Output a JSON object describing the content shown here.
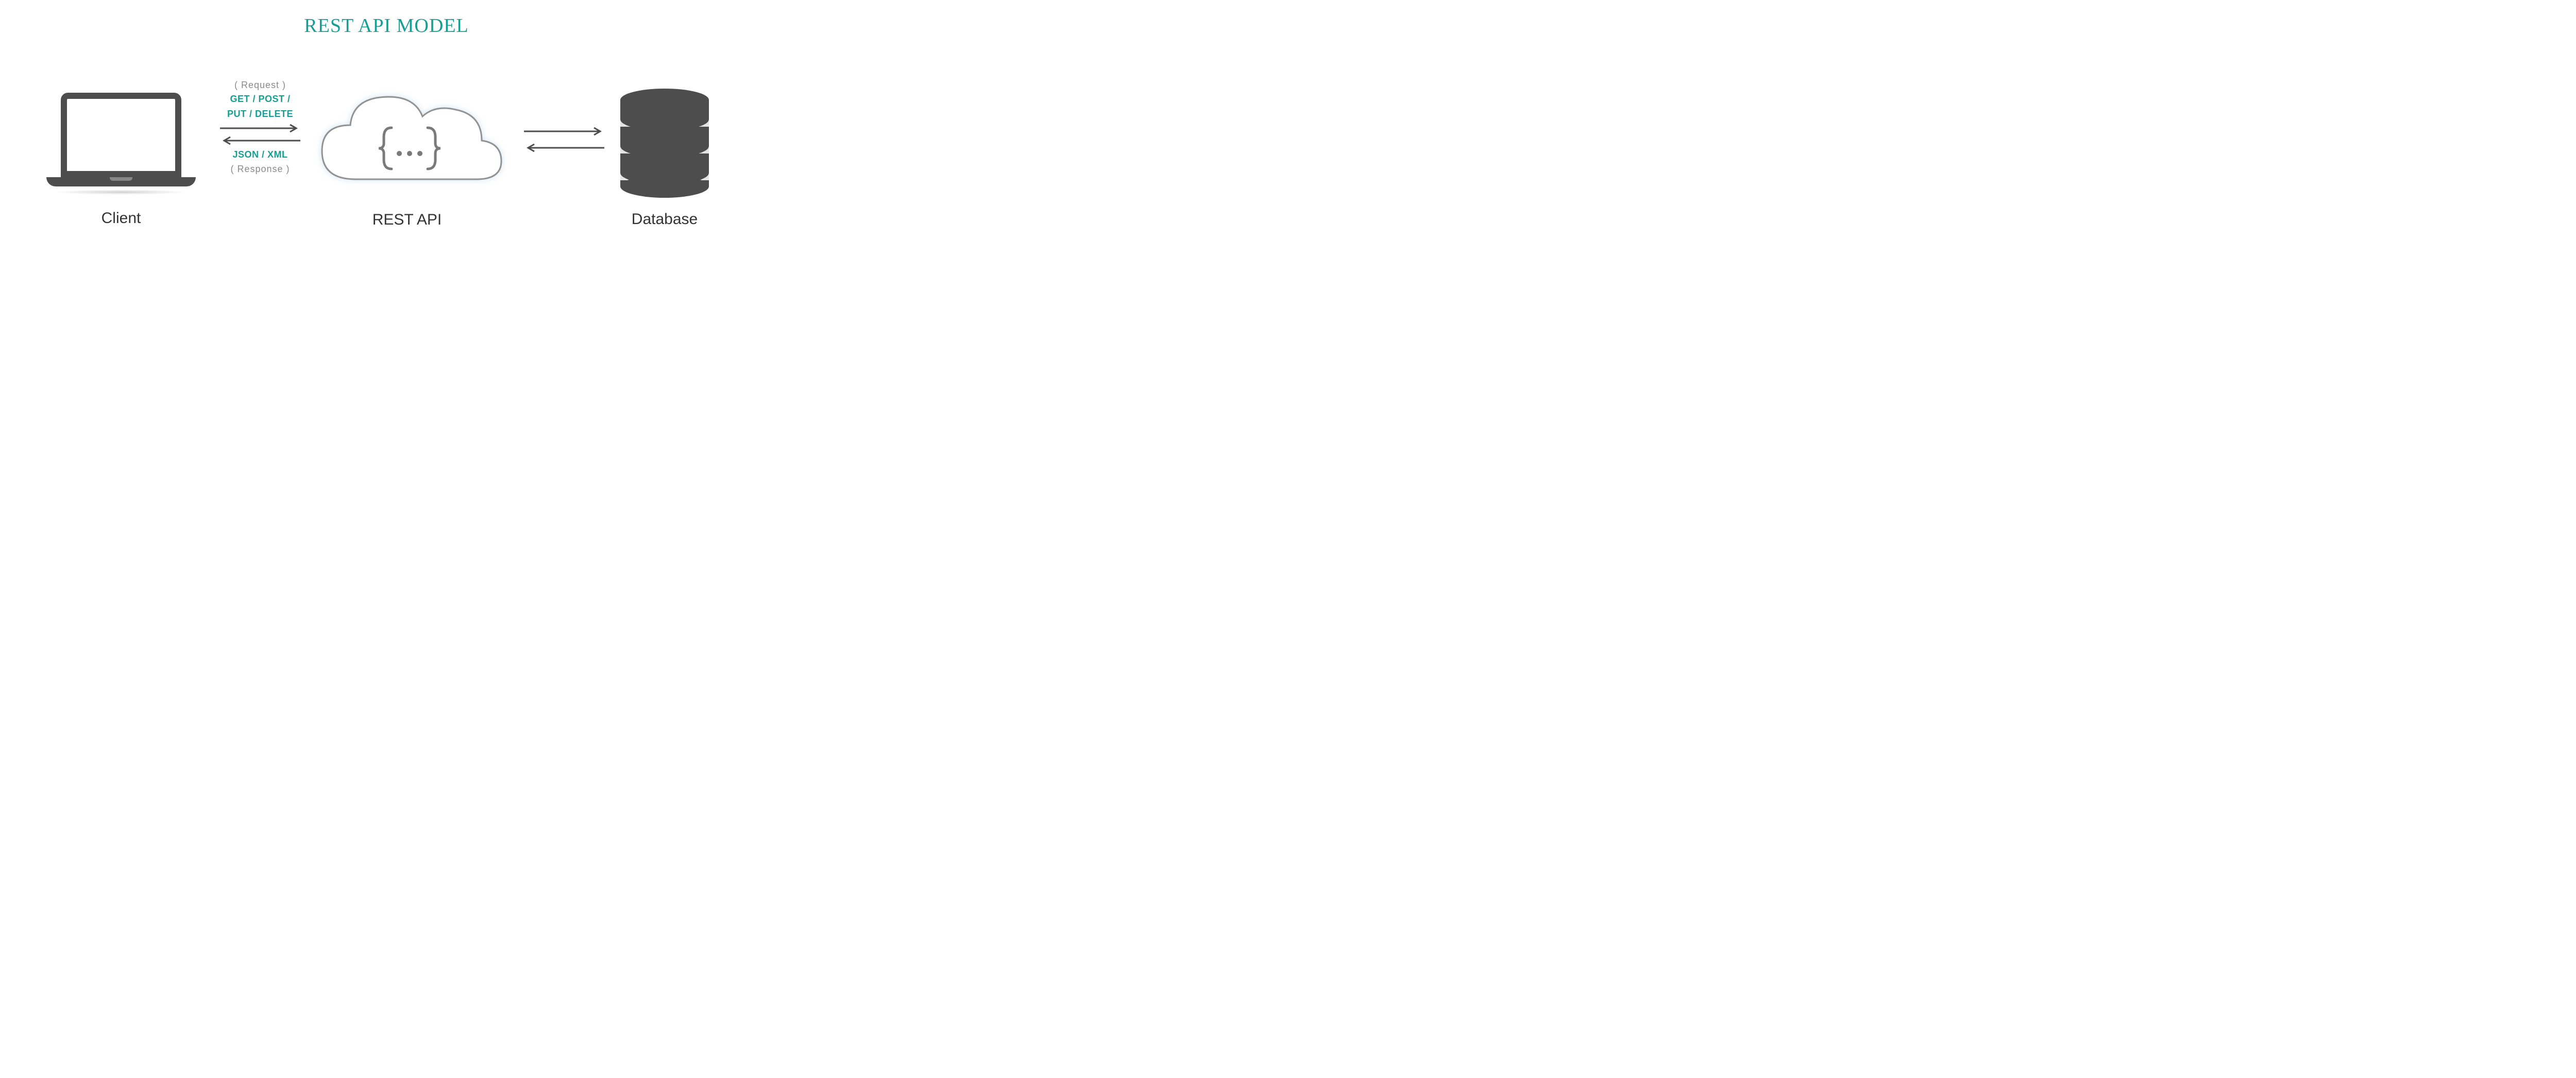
{
  "title": "REST API MODEL",
  "nodes": {
    "client": {
      "label": "Client"
    },
    "api": {
      "label": "REST API"
    },
    "database": {
      "label": "Database"
    }
  },
  "flow": {
    "request_label": "( Request )",
    "methods_line1": "GET / POST /",
    "methods_line2": "PUT / DELETE",
    "payload": "JSON / XML",
    "response_label": "( Response )"
  },
  "colors": {
    "accent": "#179e94",
    "icon_gray": "#4d4d4d",
    "label_gray": "#8a8a8a"
  }
}
